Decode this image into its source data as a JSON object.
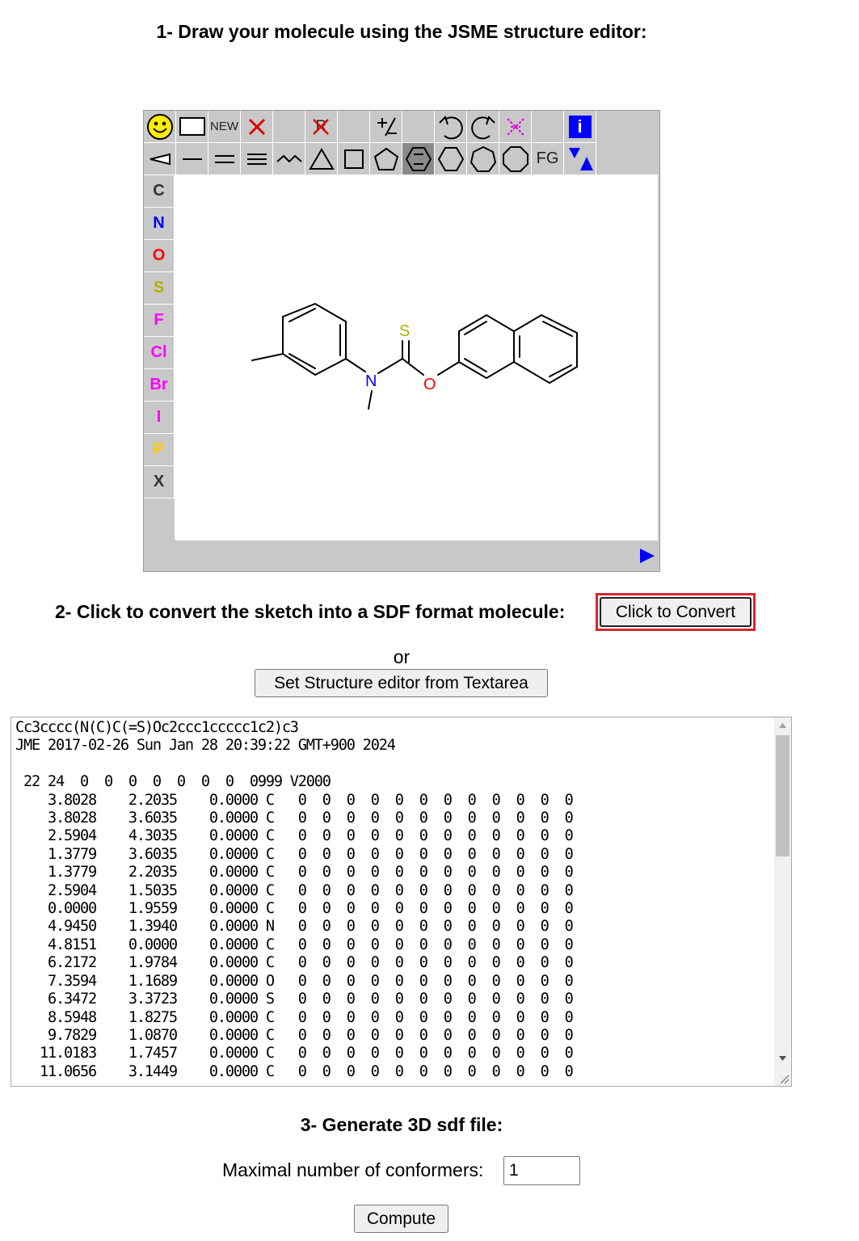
{
  "step1": {
    "title": "1- Draw your molecule using the JSME structure editor:"
  },
  "jsme": {
    "toolbar_row1": [
      "smiley-icon",
      "rectangle-icon",
      "NEW",
      "delete-x-icon",
      "",
      "R",
      "",
      "±",
      "",
      "undo-icon",
      "redo-icon",
      "clear-icon",
      "",
      "i"
    ],
    "new_label": "NEW",
    "r_label": "R",
    "charge_label": "+/−",
    "fg_label": "FG",
    "info_label": "i",
    "atoms": [
      {
        "symbol": "C",
        "color": "#333333"
      },
      {
        "symbol": "N",
        "color": "#0000ff"
      },
      {
        "symbol": "O",
        "color": "#ff0000"
      },
      {
        "symbol": "S",
        "color": "#b0b000"
      },
      {
        "symbol": "F",
        "color": "#ff00ff"
      },
      {
        "symbol": "Cl",
        "color": "#ff00ff"
      },
      {
        "symbol": "Br",
        "color": "#ff00ff"
      },
      {
        "symbol": "I",
        "color": "#ff00ff"
      },
      {
        "symbol": "P",
        "color": "#ffcc00"
      },
      {
        "symbol": "X",
        "color": "#333333"
      }
    ],
    "molecule_labels": {
      "s": "S",
      "n": "N",
      "o": "O"
    },
    "colors": {
      "accent_blue": "#0000ff",
      "frame": "#c8c8c8",
      "selected": "#8a8a8a"
    }
  },
  "step2": {
    "title": "2- Click to convert the sketch into a SDF format molecule:",
    "convert_button": "Click to Convert",
    "or_text": "or",
    "set_editor_button": "Set Structure editor from Textarea"
  },
  "textarea": {
    "content": "Cc3cccc(N(C)C(=S)Oc2ccc1ccccc1c2)c3\nJME 2017-02-26 Sun Jan 28 20:39:22 GMT+900 2024\n\n 22 24  0  0  0  0  0  0  0  0999 V2000\n    3.8028    2.2035    0.0000 C   0  0  0  0  0  0  0  0  0  0  0  0\n    3.8028    3.6035    0.0000 C   0  0  0  0  0  0  0  0  0  0  0  0\n    2.5904    4.3035    0.0000 C   0  0  0  0  0  0  0  0  0  0  0  0\n    1.3779    3.6035    0.0000 C   0  0  0  0  0  0  0  0  0  0  0  0\n    1.3779    2.2035    0.0000 C   0  0  0  0  0  0  0  0  0  0  0  0\n    2.5904    1.5035    0.0000 C   0  0  0  0  0  0  0  0  0  0  0  0\n    0.0000    1.9559    0.0000 C   0  0  0  0  0  0  0  0  0  0  0  0\n    4.9450    1.3940    0.0000 N   0  0  0  0  0  0  0  0  0  0  0  0\n    4.8151    0.0000    0.0000 C   0  0  0  0  0  0  0  0  0  0  0  0\n    6.2172    1.9784    0.0000 C   0  0  0  0  0  0  0  0  0  0  0  0\n    7.3594    1.1689    0.0000 O   0  0  0  0  0  0  0  0  0  0  0  0\n    6.3472    3.3723    0.0000 S   0  0  0  0  0  0  0  0  0  0  0  0\n    8.5948    1.8275    0.0000 C   0  0  0  0  0  0  0  0  0  0  0  0\n    9.7829    1.0870    0.0000 C   0  0  0  0  0  0  0  0  0  0  0  0\n   11.0183    1.7457    0.0000 C   0  0  0  0  0  0  0  0  0  0  0  0\n   11.0656    3.1449    0.0000 C   0  0  0  0  0  0  0  0  0  0  0  0"
  },
  "step3": {
    "title": "3- Generate 3D sdf file:",
    "conformers_label": "Maximal number of conformers:",
    "conformers_value": "1",
    "compute_button": "Compute"
  }
}
